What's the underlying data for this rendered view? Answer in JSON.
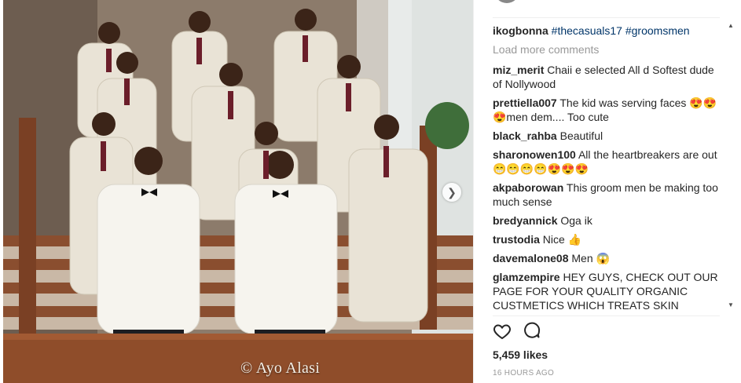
{
  "photo": {
    "watermark": "© Ayo Alasi",
    "next_icon": "chevron-right-icon"
  },
  "caption": {
    "user": "ikogbonna",
    "hashtags": "#thecasuals17 #groomsmen"
  },
  "load_more": "Load more comments",
  "comments": [
    {
      "user": "miz_merit",
      "text": "Chaii e selected All d Softest dude of Nollywood"
    },
    {
      "user": "prettiella007",
      "text": "The kid was serving faces 😍😍😍men dem.... Too cute"
    },
    {
      "user": "black_rahba",
      "text": "Beautiful"
    },
    {
      "user": "sharonowen100",
      "text": "All the heartbreakers are out😁😁😁😁😍😍😍"
    },
    {
      "user": "akpaborowan",
      "text": "This groom men be making too much sense"
    },
    {
      "user": "bredyannick",
      "text": "Oga ik"
    },
    {
      "user": "trustodia",
      "text": "Nice 👍"
    },
    {
      "user": "davemalone08",
      "text": "Men 😱"
    },
    {
      "user": "glamzempire",
      "text": "HEY GUYS, CHECK OUT OUR PAGE FOR YOUR QUALITY ORGANIC CUSTMETICS WHICH TREATS SKIN"
    }
  ],
  "actions": {
    "like_icon": "heart-icon",
    "comment_icon": "comment-bubble-icon"
  },
  "likes": "5,459 likes",
  "timestamp": "16 HOURS AGO"
}
